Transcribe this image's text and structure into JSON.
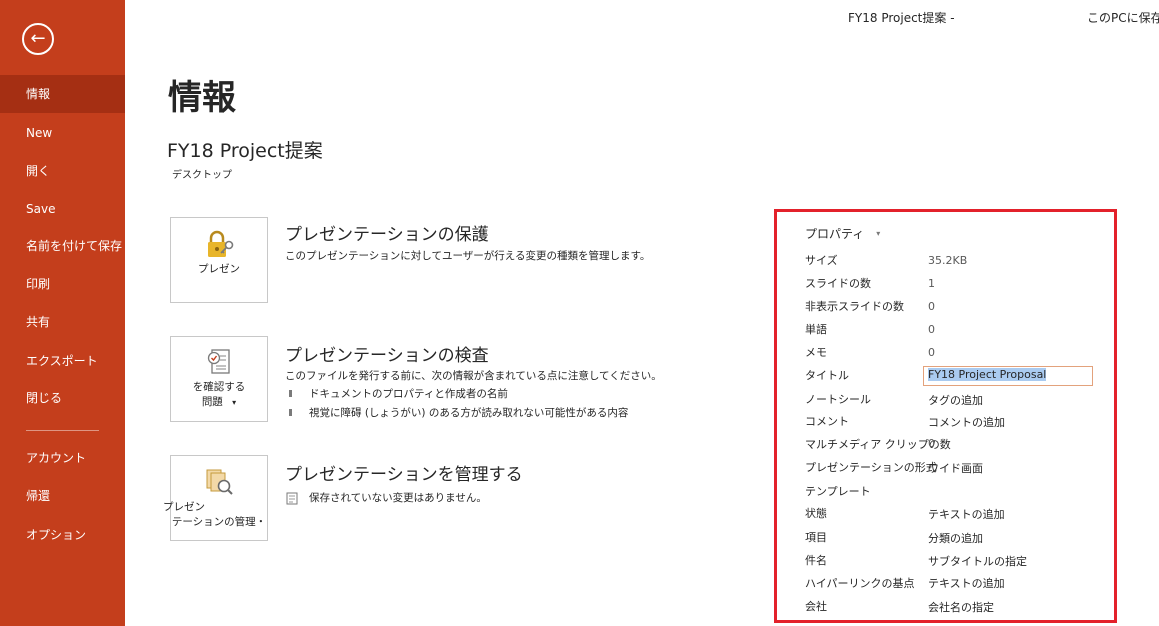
{
  "window": {
    "doc_title": "FY18 Project提案 -",
    "location": "このPCに保存"
  },
  "sidebar": {
    "back_label": "←",
    "items": [
      {
        "label": "情報",
        "active": true
      },
      {
        "label": "New"
      },
      {
        "label": "開く"
      },
      {
        "label": "Save"
      },
      {
        "label": "名前を付けて保存"
      },
      {
        "label": "印刷"
      },
      {
        "label": "共有"
      },
      {
        "label": "エクスポート"
      },
      {
        "label": "閉じる"
      },
      {
        "label": "アカウント"
      },
      {
        "label": "帰還"
      },
      {
        "label": "オプション"
      }
    ]
  },
  "main": {
    "page_title": "情報",
    "doc_name": "FY18 Project提案",
    "doc_path": "デスクトップ",
    "protect": {
      "tile_label": "プレゼン",
      "title": "プレゼンテーションの保護",
      "desc": "このプレゼンテーションに対してユーザーが行える変更の種類を管理します。"
    },
    "inspect": {
      "tile_label_1": "を確認する",
      "tile_label_2": "問題",
      "tile_caret": "▾",
      "title": "プレゼンテーションの検査",
      "desc": "このファイルを発行する前に、次の情報が含まれている点に注意してください。",
      "bullets": [
        "ドキュメントのプロパティと作成者の名前",
        "視覚に障碍 (しょうがい) のある方が読み取れない可能性がある内容"
      ]
    },
    "manage": {
      "tile_label_1": "プレゼン",
      "tile_label_2": "テーションの管理・",
      "title": "プレゼンテーションを管理する",
      "desc": "保存されていない変更はありません。"
    }
  },
  "properties": {
    "header": "プロパティ",
    "header_caret": "▾",
    "rows": [
      {
        "label": "サイズ",
        "value": "35.2KB"
      },
      {
        "label": "スライドの数",
        "value": "1"
      },
      {
        "label": "非表示スライドの数",
        "value": "0"
      },
      {
        "label": "単語",
        "value": "0"
      },
      {
        "label": "メモ",
        "value": "0"
      },
      {
        "label": "タイトル",
        "value": "FY18 Project Proposal"
      },
      {
        "label": "ノートシール",
        "value": "タグの追加"
      },
      {
        "label": "コメント",
        "value": "コメントの追加"
      },
      {
        "label": "マルチメディア クリップの数",
        "value": "0"
      },
      {
        "label": "プレゼンテーションの形式",
        "value": "ワイド画面"
      },
      {
        "label": "テンプレート",
        "value": ""
      },
      {
        "label": "状態",
        "value": "テキストの追加"
      },
      {
        "label": "項目",
        "value": "分類の追加"
      },
      {
        "label": "件名",
        "value": "サブタイトルの指定"
      },
      {
        "label": "ハイパーリンクの基点",
        "value": "テキストの追加"
      },
      {
        "label": "会社",
        "value": "会社名の指定"
      }
    ]
  },
  "colors": {
    "sidebar": "#c43e1c",
    "sidebar_active": "#a52f13",
    "highlight_border": "#e3212b"
  }
}
